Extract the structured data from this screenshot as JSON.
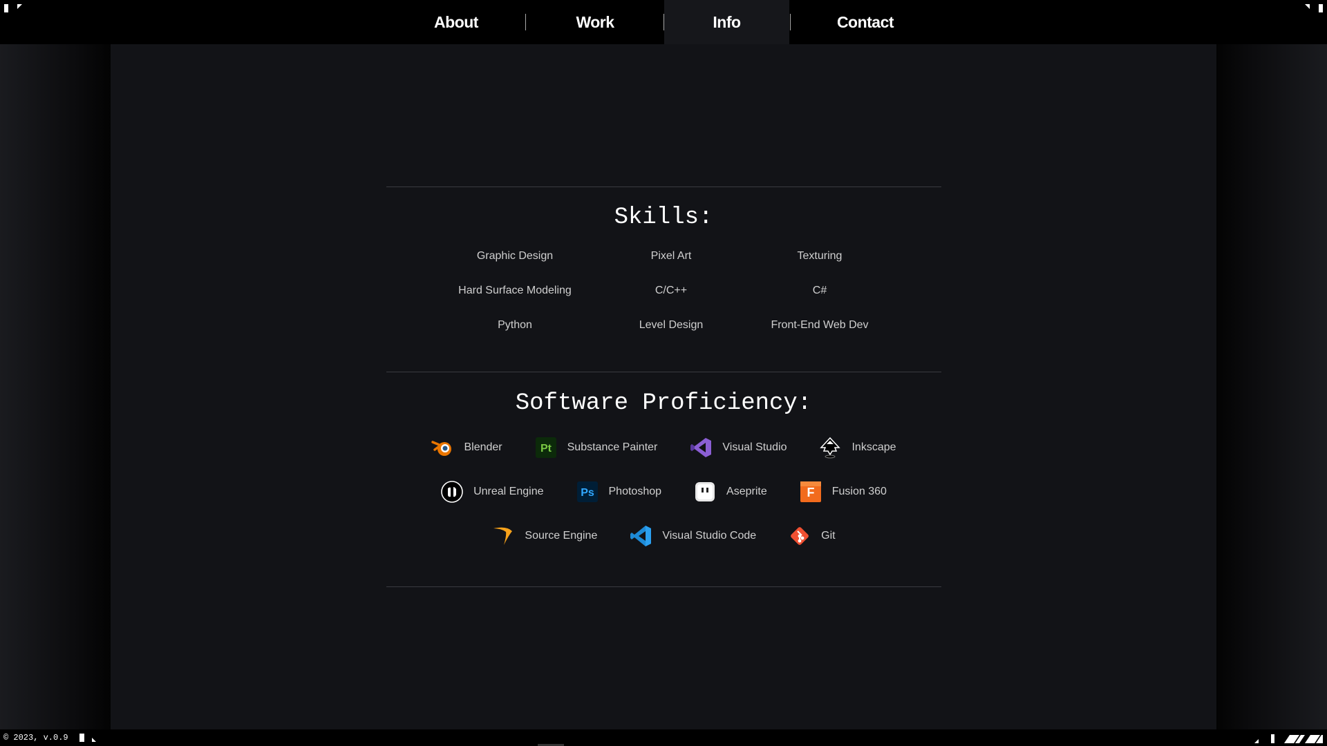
{
  "nav": {
    "items": [
      {
        "label": "About"
      },
      {
        "label": "Work"
      },
      {
        "label": "Info",
        "active": true
      },
      {
        "label": "Contact"
      }
    ]
  },
  "skills": {
    "heading": "Skills:",
    "items": [
      "Graphic Design",
      "Pixel Art",
      "Texturing",
      "Hard Surface Modeling",
      "C/C++",
      "C#",
      "Python",
      "Level Design",
      "Front-End Web Dev"
    ]
  },
  "software": {
    "heading": "Software Proficiency:",
    "rows": [
      [
        {
          "label": "Blender",
          "icon": "blender-icon"
        },
        {
          "label": "Substance Painter",
          "icon": "substance-painter-icon"
        },
        {
          "label": "Visual Studio",
          "icon": "visual-studio-icon"
        },
        {
          "label": "Inkscape",
          "icon": "inkscape-icon"
        }
      ],
      [
        {
          "label": "Unreal Engine",
          "icon": "unreal-engine-icon"
        },
        {
          "label": "Photoshop",
          "icon": "photoshop-icon"
        },
        {
          "label": "Aseprite",
          "icon": "aseprite-icon"
        },
        {
          "label": "Fusion 360",
          "icon": "fusion-360-icon"
        }
      ],
      [
        {
          "label": "Source Engine",
          "icon": "source-engine-icon"
        },
        {
          "label": "Visual Studio Code",
          "icon": "visual-studio-code-icon"
        },
        {
          "label": "Git",
          "icon": "git-icon"
        }
      ]
    ]
  },
  "icon_text": {
    "substance_painter": "Pt",
    "photoshop": "Ps",
    "fusion_360": "F"
  },
  "footer": {
    "copyright": "© 2023, v.0.9"
  },
  "colors": {
    "background": "#000000",
    "panel": "#121317",
    "active_tab": "#16171b",
    "text": "#ffffff",
    "muted_text": "#d0d0d0",
    "rule": "#3a3b40"
  }
}
